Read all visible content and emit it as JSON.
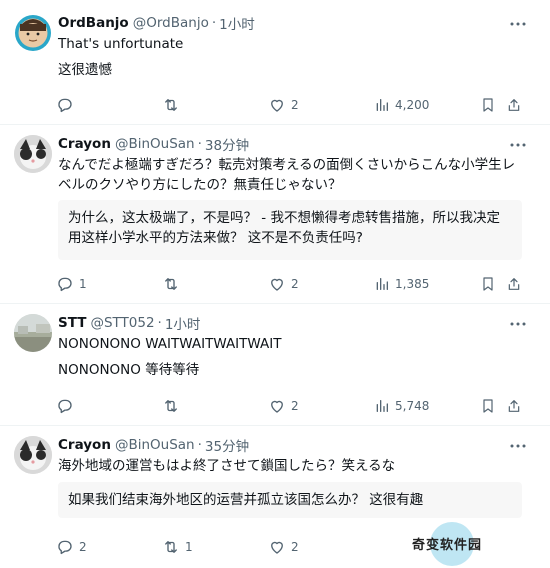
{
  "posts": [
    {
      "name": "OrdBanjo",
      "handle": "@OrdBanjo",
      "time": "1小时",
      "text": "That's unfortunate",
      "translation_plain": "这很遗憾",
      "actions": {
        "reply": "",
        "repost": "",
        "like": "2",
        "views": "4,200"
      }
    },
    {
      "name": "Crayon",
      "handle": "@BinOuSan",
      "time": "38分钟",
      "text": "なんでだよ極端すぎだろ？転売対策考えるの面倒くさいからこんな小学生レベルのクソやり方にしたの？無責任じゃない？",
      "translation": "为什么，这太极端了，不是吗？ - 我不想懒得考虑转售措施，所以我决定用这样小学水平的方法来做？ 这不是不负责任吗?",
      "actions": {
        "reply": "1",
        "repost": "",
        "like": "2",
        "views": "1,385"
      }
    },
    {
      "name": "STT",
      "handle": "@STT052",
      "time": "1小时",
      "text": "NONONONO WAITWAITWAITWAIT",
      "translation_plain": "NONONONO 等待等待",
      "actions": {
        "reply": "",
        "repost": "",
        "like": "2",
        "views": "5,748"
      }
    },
    {
      "name": "Crayon",
      "handle": "@BinOuSan",
      "time": "35分钟",
      "text": "海外地域の運営もはよ終了させて鎖国したら？笑えるな",
      "translation": "如果我们结束海外地区的运营并孤立该国怎么办？ 这很有趣",
      "actions": {
        "reply": "2",
        "repost": "1",
        "like": "2",
        "views": ""
      }
    }
  ],
  "watermark": "奇变软件园",
  "icons": {
    "reply": "reply-icon",
    "repost": "repost-icon",
    "like": "heart-icon",
    "views": "views-icon",
    "bookmark": "bookmark-icon",
    "share": "share-icon",
    "more": "more-icon"
  },
  "colors": {
    "muted": "#536471",
    "text": "#0f1419",
    "divider": "#eff3f4"
  }
}
